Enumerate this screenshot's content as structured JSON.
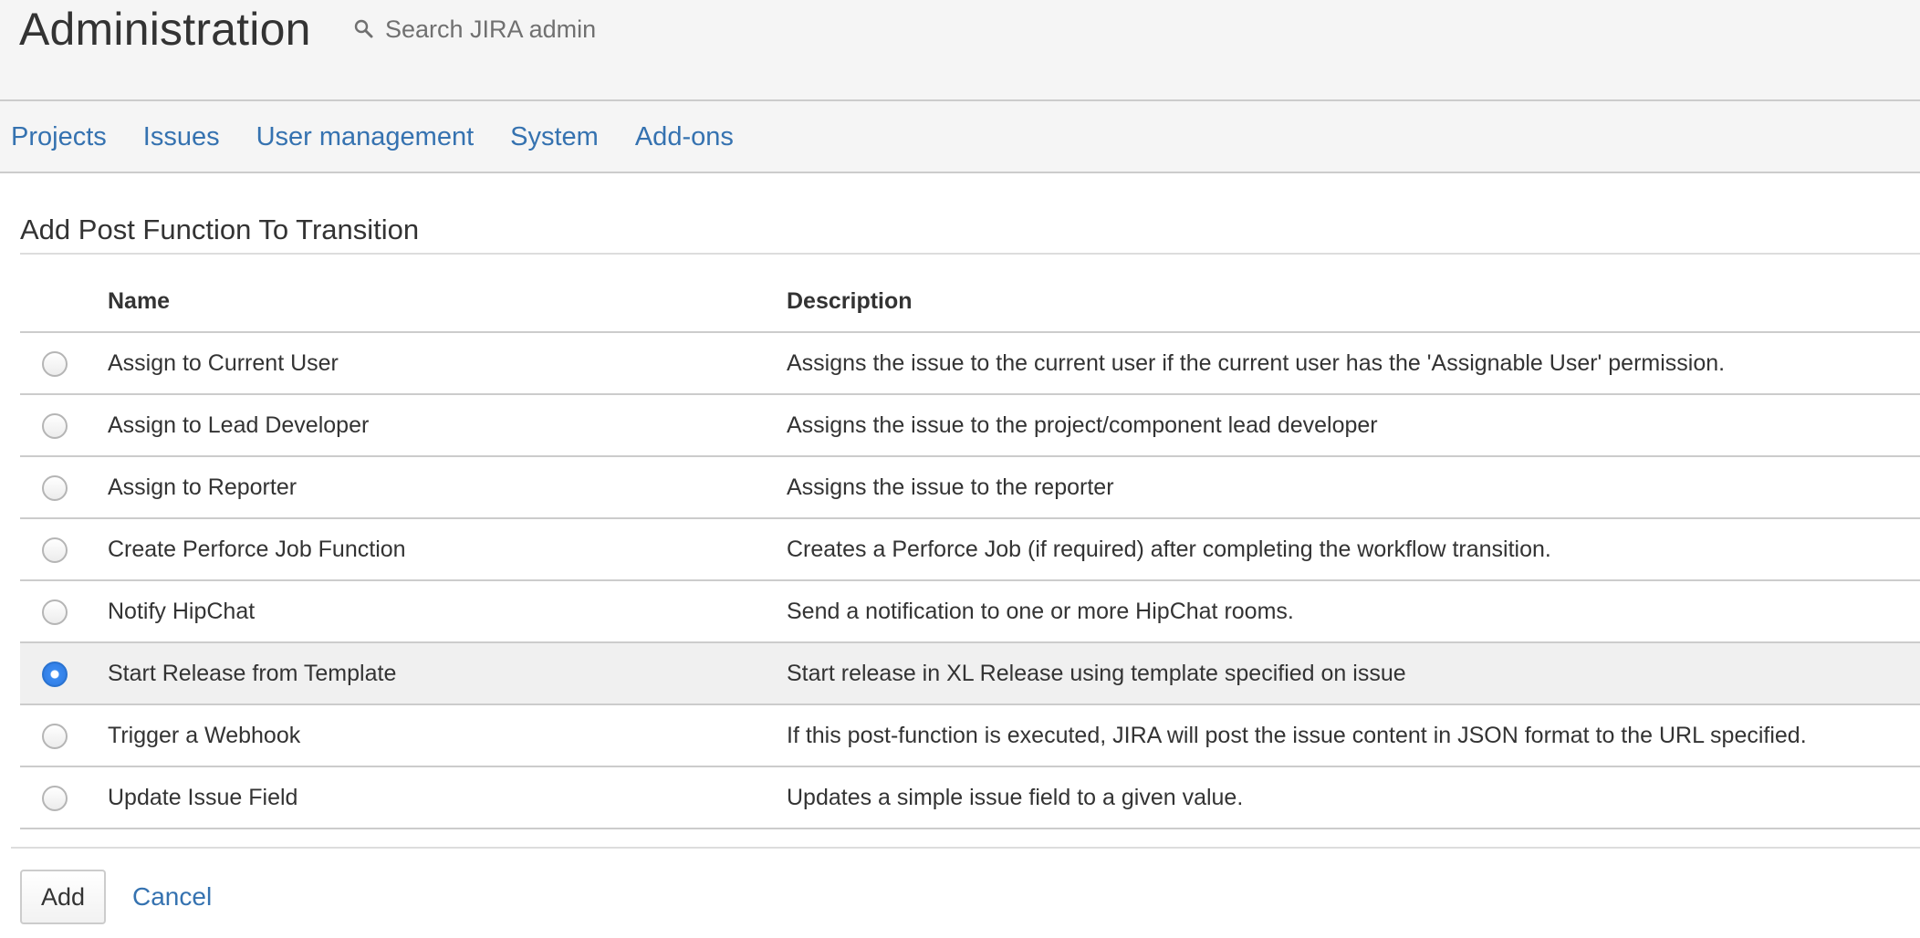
{
  "header": {
    "title": "Administration",
    "search_placeholder": "Search JIRA admin"
  },
  "nav": {
    "items": [
      {
        "label": "Projects"
      },
      {
        "label": "Issues"
      },
      {
        "label": "User management"
      },
      {
        "label": "System"
      },
      {
        "label": "Add-ons"
      }
    ]
  },
  "page": {
    "title": "Add Post Function To Transition"
  },
  "table": {
    "columns": [
      "Name",
      "Description"
    ],
    "rows": [
      {
        "name": "Assign to Current User",
        "description": "Assigns the issue to the current user if the current user has the 'Assignable User' permission.",
        "selected": false
      },
      {
        "name": "Assign to Lead Developer",
        "description": "Assigns the issue to the project/component lead developer",
        "selected": false
      },
      {
        "name": "Assign to Reporter",
        "description": "Assigns the issue to the reporter",
        "selected": false
      },
      {
        "name": "Create Perforce Job Function",
        "description": "Creates a Perforce Job (if required) after completing the workflow transition.",
        "selected": false
      },
      {
        "name": "Notify HipChat",
        "description": "Send a notification to one or more HipChat rooms.",
        "selected": false
      },
      {
        "name": "Start Release from Template",
        "description": "Start release in XL Release using template specified on issue",
        "selected": true
      },
      {
        "name": "Trigger a Webhook",
        "description": "If this post-function is executed, JIRA will post the issue content in JSON format to the URL specified.",
        "selected": false
      },
      {
        "name": "Update Issue Field",
        "description": "Updates a simple issue field to a given value.",
        "selected": false
      }
    ]
  },
  "actions": {
    "add_label": "Add",
    "cancel_label": "Cancel"
  },
  "colors": {
    "link": "#3572b0",
    "header_bg": "#f5f5f5",
    "selected_row_bg": "#f0f0f0",
    "radio_checked": "#2d78e0"
  },
  "icons": {
    "search": "search-icon"
  }
}
